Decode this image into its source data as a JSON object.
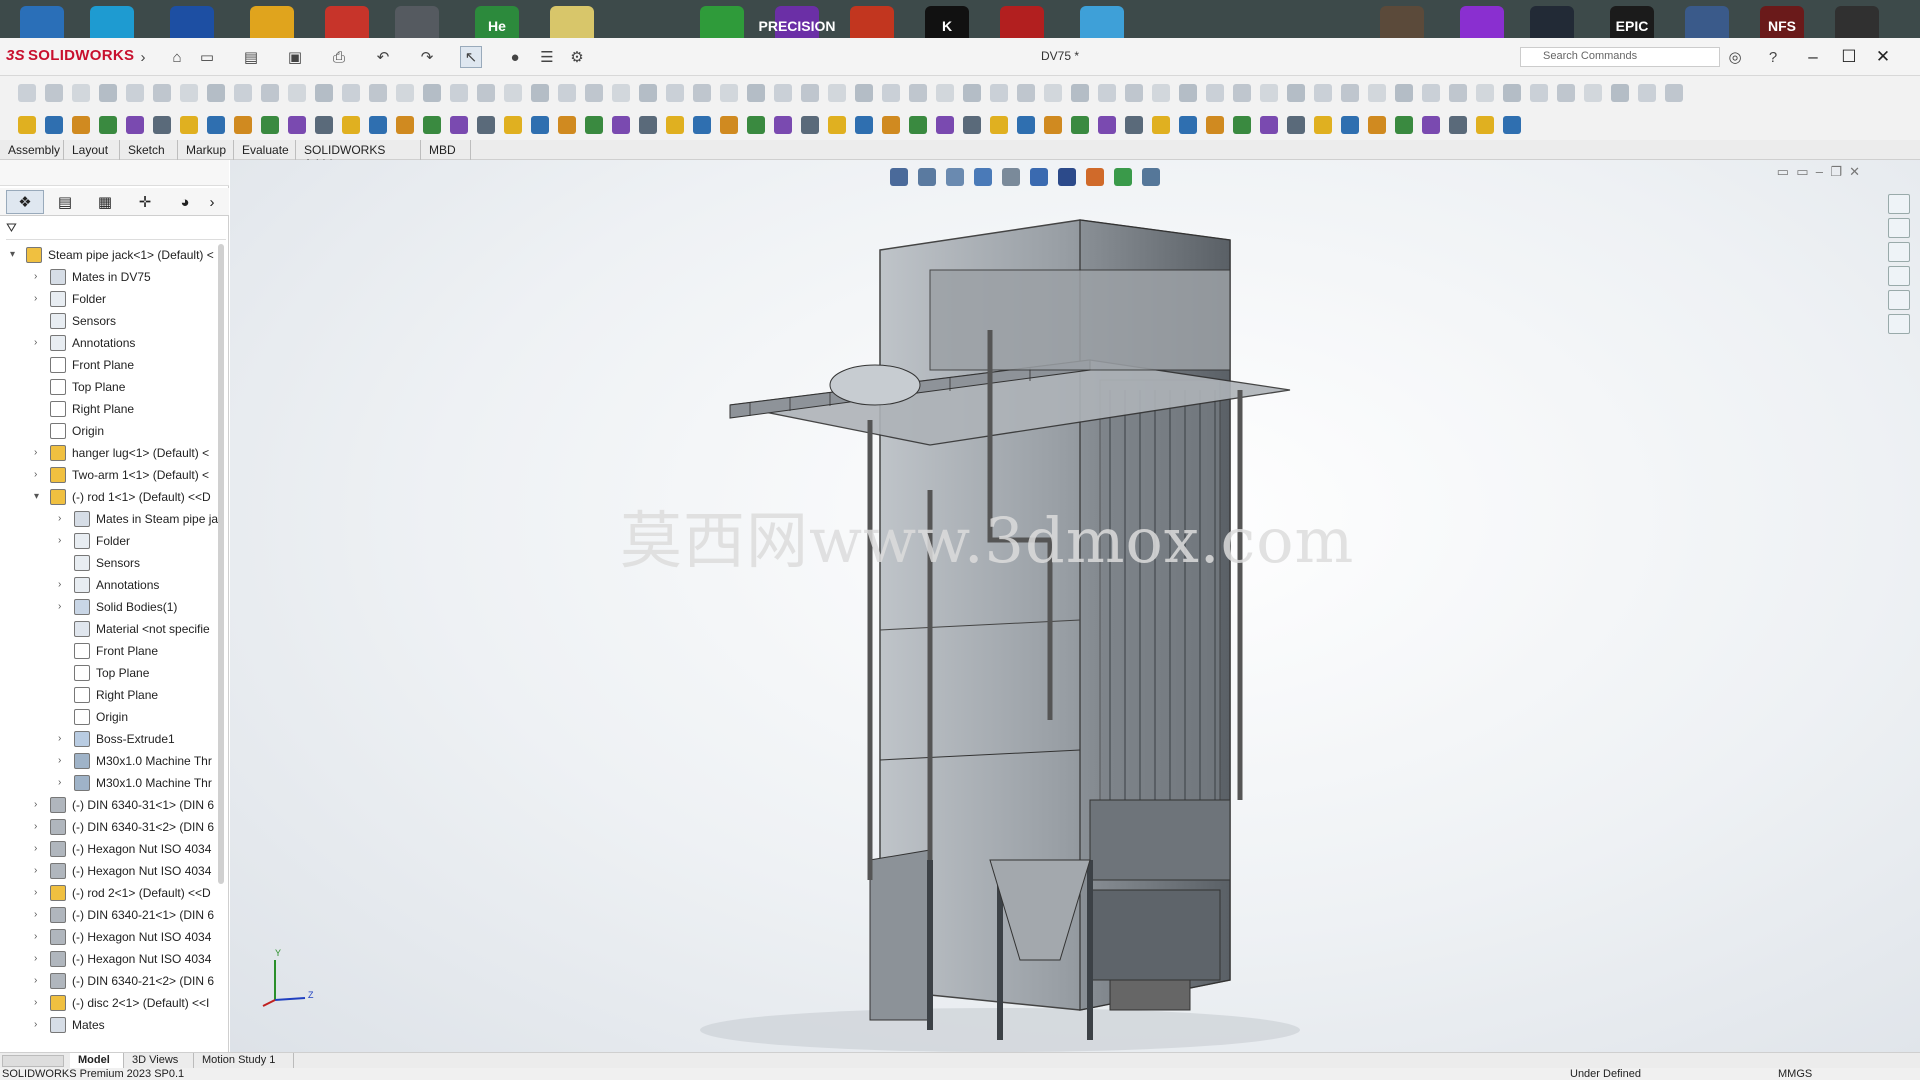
{
  "window": {
    "document_title": "DV75 *",
    "search_placeholder": "Search Commands"
  },
  "logo": {
    "brand_prefix": "3S",
    "brand_name": "SOLIDWORKS"
  },
  "dock": [
    {
      "label": "",
      "color": "#2a6fb8"
    },
    {
      "label": "",
      "color": "#1e9bd1"
    },
    {
      "label": "",
      "color": "#1d4fa3"
    },
    {
      "label": "",
      "color": "#e0a41d"
    },
    {
      "label": "",
      "color": "#c7342a"
    },
    {
      "label": "",
      "color": "#555a60"
    },
    {
      "label": "He",
      "color": "#2c8a3c"
    },
    {
      "label": "",
      "color": "#d8c66a"
    },
    {
      "label": "",
      "color": "#2f9b3a"
    },
    {
      "label": "PRECISION",
      "color": "#6b2fa6"
    },
    {
      "label": "",
      "color": "#c2361f"
    },
    {
      "label": "K",
      "color": "#111111"
    },
    {
      "label": "",
      "color": "#b21f1f"
    },
    {
      "label": "",
      "color": "#3ea0d8"
    },
    {
      "label": "",
      "color": "#5b4a3a"
    },
    {
      "label": "",
      "color": "#8a2fd0"
    },
    {
      "label": "",
      "color": "#222a36"
    },
    {
      "label": "EPIC",
      "color": "#1b1b1b"
    },
    {
      "label": "",
      "color": "#3a5a8a"
    },
    {
      "label": "NFS",
      "color": "#6a1a1a"
    },
    {
      "label": "",
      "color": "#303030"
    }
  ],
  "command_tabs": [
    "Assembly",
    "Layout",
    "Sketch",
    "Markup",
    "Evaluate",
    "SOLIDWORKS Add-Ins",
    "MBD"
  ],
  "feature_tree": [
    {
      "label": "Steam pipe jack<1> (Default) <",
      "level": 0,
      "expanded": true,
      "icon": "assembly-icon"
    },
    {
      "label": "Mates in DV75",
      "level": 1,
      "expanded": false,
      "icon": "mates-icon"
    },
    {
      "label": "Folder",
      "level": 1,
      "expanded": false,
      "icon": "folder-icon"
    },
    {
      "label": "Sensors",
      "level": 1,
      "expanded": null,
      "icon": "sensor-icon"
    },
    {
      "label": "Annotations",
      "level": 1,
      "expanded": false,
      "icon": "annotation-icon"
    },
    {
      "label": "Front Plane",
      "level": 1,
      "expanded": null,
      "icon": "plane-icon"
    },
    {
      "label": "Top Plane",
      "level": 1,
      "expanded": null,
      "icon": "plane-icon"
    },
    {
      "label": "Right Plane",
      "level": 1,
      "expanded": null,
      "icon": "plane-icon"
    },
    {
      "label": "Origin",
      "level": 1,
      "expanded": null,
      "icon": "origin-icon"
    },
    {
      "label": "hanger lug<1> (Default) <",
      "level": 1,
      "expanded": false,
      "icon": "assembly-icon"
    },
    {
      "label": "Two-arm 1<1> (Default) <",
      "level": 1,
      "expanded": false,
      "icon": "assembly-icon"
    },
    {
      "label": "(-) rod 1<1> (Default) <<D",
      "level": 1,
      "expanded": true,
      "icon": "assembly-icon"
    },
    {
      "label": "Mates in Steam pipe ja",
      "level": 2,
      "expanded": false,
      "icon": "mates-icon"
    },
    {
      "label": "Folder",
      "level": 2,
      "expanded": false,
      "icon": "folder-icon"
    },
    {
      "label": "Sensors",
      "level": 2,
      "expanded": null,
      "icon": "sensor-icon"
    },
    {
      "label": "Annotations",
      "level": 2,
      "expanded": false,
      "icon": "annotation-icon"
    },
    {
      "label": "Solid Bodies(1)",
      "level": 2,
      "expanded": false,
      "icon": "solid-bodies-icon"
    },
    {
      "label": "Material <not specifie",
      "level": 2,
      "expanded": null,
      "icon": "material-icon"
    },
    {
      "label": "Front Plane",
      "level": 2,
      "expanded": null,
      "icon": "plane-icon"
    },
    {
      "label": "Top Plane",
      "level": 2,
      "expanded": null,
      "icon": "plane-icon"
    },
    {
      "label": "Right Plane",
      "level": 2,
      "expanded": null,
      "icon": "plane-icon"
    },
    {
      "label": "Origin",
      "level": 2,
      "expanded": null,
      "icon": "origin-icon"
    },
    {
      "label": "Boss-Extrude1",
      "level": 2,
      "expanded": false,
      "icon": "extrude-icon"
    },
    {
      "label": "M30x1.0 Machine Thr",
      "level": 2,
      "expanded": false,
      "icon": "thread-icon"
    },
    {
      "label": "M30x1.0 Machine Thr",
      "level": 2,
      "expanded": false,
      "icon": "thread-icon"
    },
    {
      "label": "(-) DIN 6340-31<1> (DIN 6",
      "level": 1,
      "expanded": false,
      "icon": "part-icon"
    },
    {
      "label": "(-) DIN 6340-31<2> (DIN 6",
      "level": 1,
      "expanded": false,
      "icon": "part-icon"
    },
    {
      "label": "(-) Hexagon Nut ISO 4034",
      "level": 1,
      "expanded": false,
      "icon": "part-icon"
    },
    {
      "label": "(-) Hexagon Nut ISO 4034",
      "level": 1,
      "expanded": false,
      "icon": "part-icon"
    },
    {
      "label": "(-) rod 2<1> (Default) <<D",
      "level": 1,
      "expanded": false,
      "icon": "assembly-icon"
    },
    {
      "label": "(-) DIN 6340-21<1> (DIN 6",
      "level": 1,
      "expanded": false,
      "icon": "part-icon"
    },
    {
      "label": "(-) Hexagon Nut ISO 4034",
      "level": 1,
      "expanded": false,
      "icon": "part-icon"
    },
    {
      "label": "(-) Hexagon Nut ISO 4034",
      "level": 1,
      "expanded": false,
      "icon": "part-icon"
    },
    {
      "label": "(-) DIN 6340-21<2> (DIN 6",
      "level": 1,
      "expanded": false,
      "icon": "part-icon"
    },
    {
      "label": "(-) disc 2<1> (Default) <<I",
      "level": 1,
      "expanded": false,
      "icon": "assembly-icon"
    },
    {
      "label": "Mates",
      "level": 1,
      "expanded": false,
      "icon": "mates-icon"
    }
  ],
  "watermark": "莫西网www.3dmox.com",
  "triad": {
    "y_label": "Y",
    "z_label": "Z"
  },
  "model_tabs": [
    "Model",
    "3D Views",
    "Motion Study 1"
  ],
  "status": {
    "product": "SOLIDWORKS Premium 2023 SP0.1",
    "state": "Under Defined",
    "units": "MMGS"
  }
}
